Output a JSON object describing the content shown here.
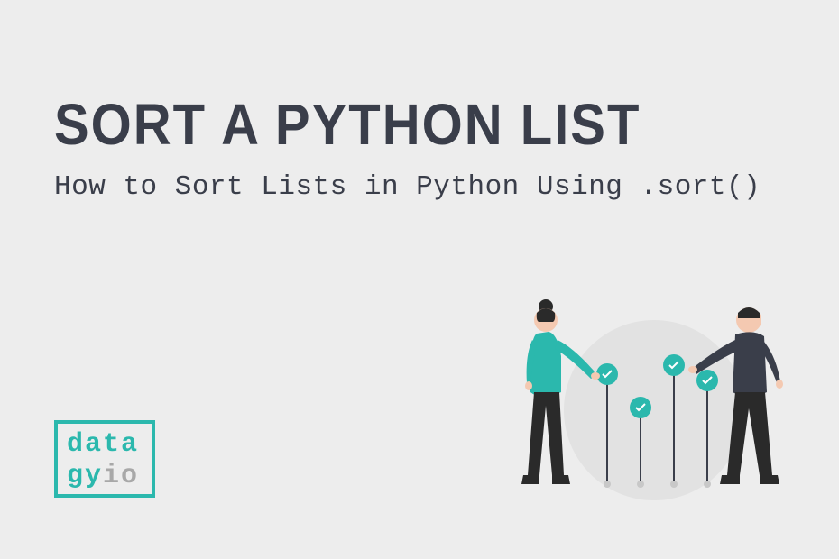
{
  "title": "SORT A PYTHON LIST",
  "subtitle": "How to Sort Lists in Python Using .sort()",
  "logo": {
    "line1": "data",
    "line2a": "gy",
    "line2b": "io"
  },
  "colors": {
    "accent": "#2bb8ad",
    "dark": "#3a3e4a",
    "bg": "#ededed",
    "muted": "#a8a8a8"
  }
}
